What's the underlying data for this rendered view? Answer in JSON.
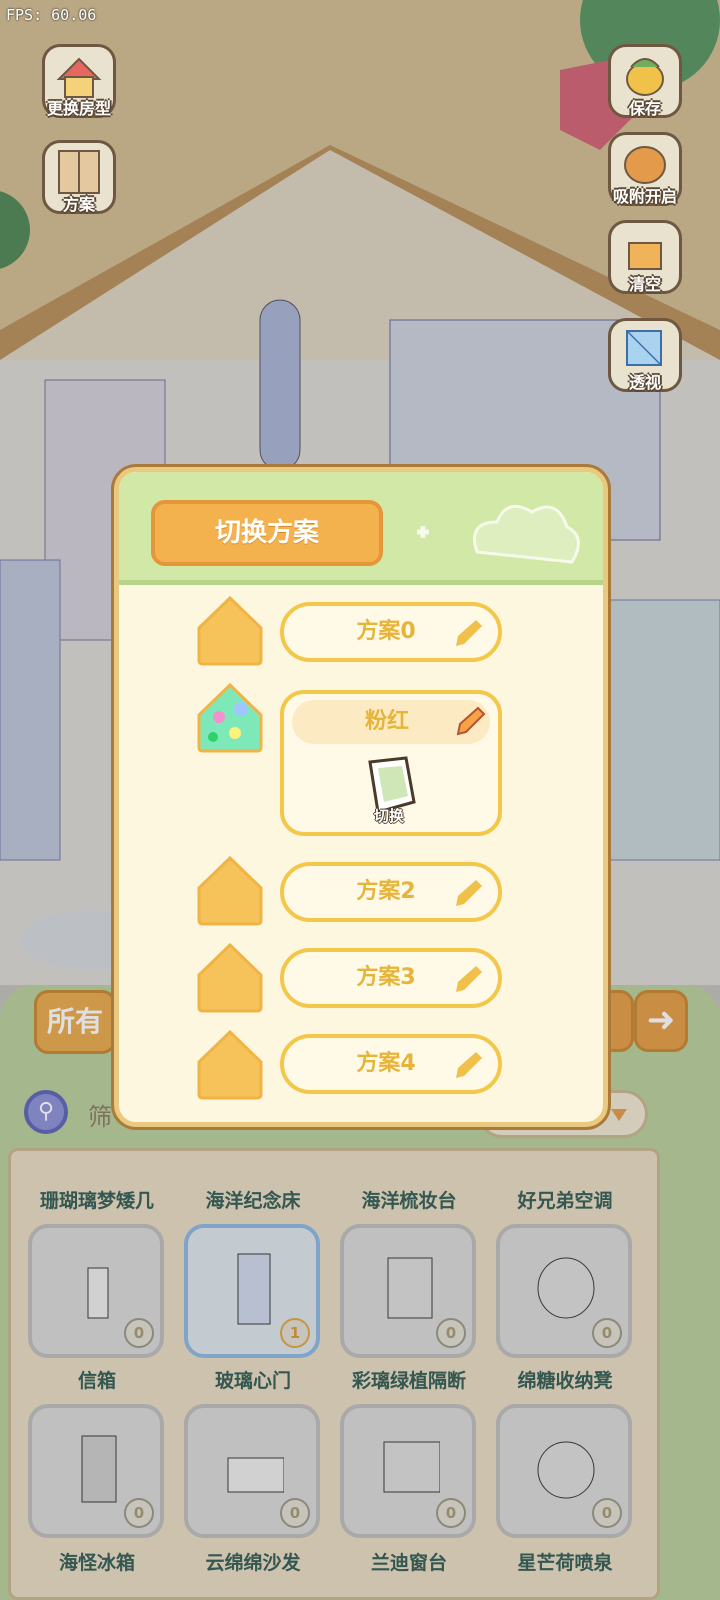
{
  "hud": {
    "fps": "FPS: 60.06"
  },
  "left_buttons": [
    {
      "label": "更换房型",
      "icon": "house-icon"
    },
    {
      "label": "方案",
      "icon": "wardrobe-icon"
    }
  ],
  "right_buttons": [
    {
      "label": "保存",
      "icon": "duck-save-icon"
    },
    {
      "label": "吸附开启",
      "icon": "magnet-icon"
    },
    {
      "label": "清空",
      "icon": "clear-icon"
    },
    {
      "label": "透视",
      "icon": "cube-icon"
    }
  ],
  "catalog": {
    "tab_all": "所有",
    "filter_label": "筛",
    "partial_row_names": [
      "珊瑚璃梦矮几",
      "海洋纪念床",
      "海洋梳妆台",
      "好兄弟空调"
    ],
    "items": [
      {
        "name": "信箱",
        "count": "0",
        "selected": false
      },
      {
        "name": "玻璃心门",
        "count": "1",
        "selected": true
      },
      {
        "name": "彩璃绿植隔断",
        "count": "0",
        "selected": false
      },
      {
        "name": "绵糖收纳凳",
        "count": "0",
        "selected": false
      },
      {
        "name": "海怪冰箱",
        "count": "0",
        "selected": false
      },
      {
        "name": "云绵绵沙发",
        "count": "0",
        "selected": false
      },
      {
        "name": "兰迪窗台",
        "count": "0",
        "selected": false
      },
      {
        "name": "星芒荷喷泉",
        "count": "0",
        "selected": false
      }
    ]
  },
  "modal": {
    "title": "切换方案",
    "plans": [
      {
        "name": "方案0"
      },
      {
        "name": "粉红",
        "active": true,
        "action": "切换"
      },
      {
        "name": "方案2"
      },
      {
        "name": "方案3"
      },
      {
        "name": "方案4"
      }
    ]
  },
  "colors": {
    "modal_header": "#d2e8a7",
    "title_orange": "#f4b24f",
    "plan_yellow": "#f2c74a",
    "catalog_green": "#b9cf9b"
  }
}
